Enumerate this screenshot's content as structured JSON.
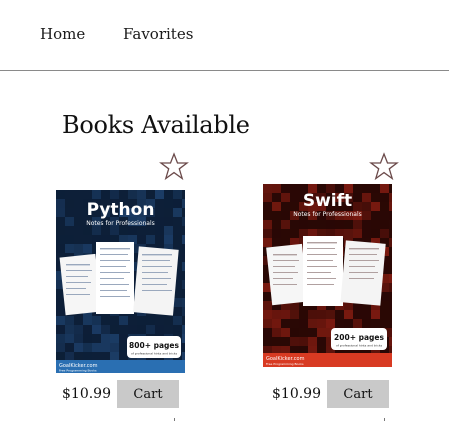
{
  "nav": {
    "links": [
      {
        "label": "Home"
      },
      {
        "label": "Favorites"
      }
    ]
  },
  "section": {
    "title": "Books Available"
  },
  "books": [
    {
      "cover_title": "Python",
      "cover_subtitle": "Notes for Professionals",
      "pages_badge": "800+ pages",
      "pages_badge_sub": "of professional hints and tricks",
      "publisher": "GoalKicker.com",
      "publisher_sub": "Free Programming Books",
      "price": "$10.99",
      "cart_label": "Cart",
      "favorite": false,
      "cover_color": "#1c3d66",
      "cover_dark": "#0d1f38",
      "footer_color": "#2a6fb2"
    },
    {
      "cover_title": "Swift",
      "cover_subtitle": "Notes for Professionals",
      "pages_badge": "200+ pages",
      "pages_badge_sub": "of professional hints and tricks",
      "publisher": "GoalKicker.com",
      "publisher_sub": "Free Programming Books",
      "price": "$10.99",
      "cart_label": "Cart",
      "favorite": false,
      "cover_color": "#7a1a10",
      "cover_dark": "#2a0805",
      "footer_color": "#d83a22"
    }
  ],
  "icons": {
    "favorite": "star-outline-icon"
  },
  "colors": {
    "star_outline": "#6b4a4a",
    "cart_button": "#c9c9c9",
    "divider": "#8a8a8a"
  }
}
